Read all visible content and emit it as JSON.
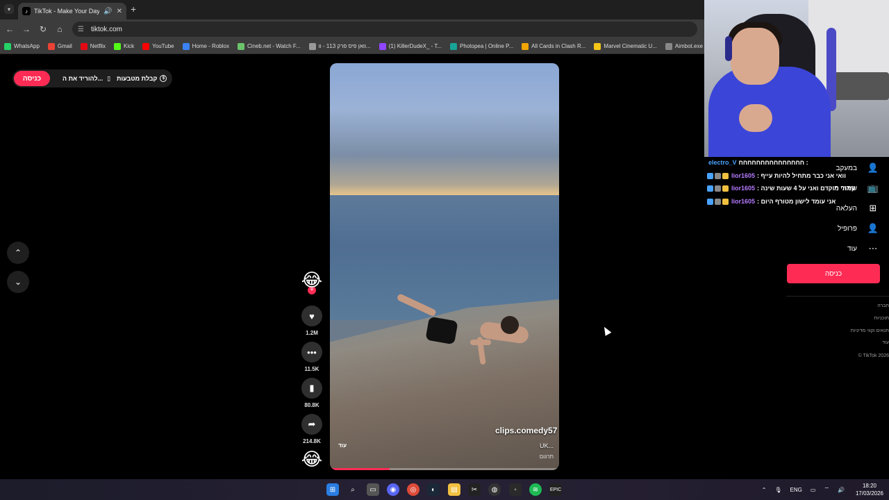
{
  "browser": {
    "tab_title": "TikTok - Make Your Day",
    "tab_favicon": "♪",
    "url": "tiktok.com",
    "bookmarks": [
      {
        "label": "WhatsApp",
        "color": "#25d366"
      },
      {
        "label": "Gmail",
        "color": "#ea4335"
      },
      {
        "label": "Netflix",
        "color": "#e50914"
      },
      {
        "label": "Kick",
        "color": "#53fc18"
      },
      {
        "label": "YouTube",
        "color": "#ff0000"
      },
      {
        "label": "Home - Roblox",
        "color": "#3b82f6"
      },
      {
        "label": "Cineb.net - Watch F...",
        "color": "#6bc46b"
      },
      {
        "label": "וואן פיס פרק 113 - וו...",
        "color": "#999999"
      },
      {
        "label": "(1) KillerDudeX_ - T...",
        "color": "#9146ff"
      },
      {
        "label": "Photopea | Online P...",
        "color": "#18a497"
      },
      {
        "label": "All Cards in Clash R...",
        "color": "#f0a500"
      },
      {
        "label": "Marvel Cinematic U...",
        "color": "#f5c518"
      },
      {
        "label": "Aimbot.exe",
        "color": "#888888"
      }
    ]
  },
  "tiktok": {
    "login_label": "כניסה",
    "download_label": "להוריד את ה...",
    "coins_label": "קבלת מטבעות",
    "author": "clips.comedy57",
    "caption": "UK...",
    "more_label": "עוד",
    "translate_label": "תרגום",
    "progress": 0.26,
    "actions": {
      "likes": "1.2M",
      "comments": "11.5K",
      "saves": "80.8K",
      "shares": "214.8K"
    }
  },
  "sidebar": {
    "items": [
      {
        "label": "במעקב",
        "icon": "user-plus-icon"
      },
      {
        "label": "שידור חי",
        "icon": "live-tv-icon"
      },
      {
        "label": "העלאה",
        "icon": "upload-plus-icon"
      },
      {
        "label": "פרופיל",
        "icon": "profile-icon"
      },
      {
        "label": "עוד",
        "icon": "more-dots-icon"
      }
    ],
    "login_label": "כניסה",
    "footer": [
      "חברה",
      "תוכניות",
      "תנאים וקווי מדיניות",
      "עוד",
      "© TikTok 2026"
    ]
  },
  "chat": [
    {
      "user": "electro_V",
      "user_color": "#4aa3ff",
      "message": "חחחחחחחחחחחחחחח :"
    },
    {
      "user": "lior1605",
      "user_color": "#b57bff",
      "message": ": וואי אני כבר מתחיל להיות עייף"
    },
    {
      "user": "lior1605",
      "user_color": "#b57bff",
      "message": ": קמתי מוקדם ואני על 4 שעות שינה"
    },
    {
      "user": "lior1605",
      "user_color": "#b57bff",
      "message": ": אני עומד לישון מטורף היום"
    }
  ],
  "taskbar": {
    "lang": "ENG",
    "time": "18:20",
    "date": "17/03/2026"
  }
}
